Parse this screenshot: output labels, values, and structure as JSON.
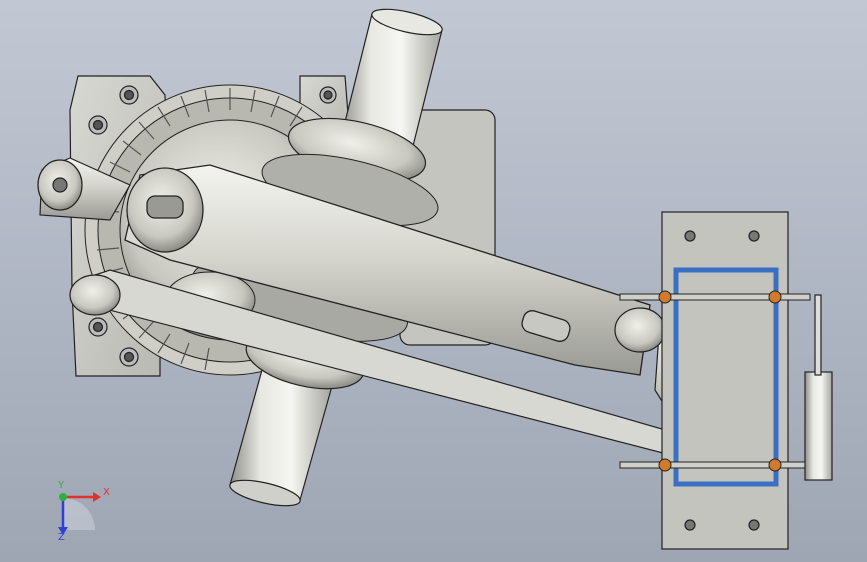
{
  "scene": {
    "background_top": "#c2c8d3",
    "background_bottom": "#9ea6b4",
    "metal_light": "#e6e6e0",
    "metal_mid": "#c9c9c2",
    "metal_dark": "#8e8e88",
    "rail_blue": "#3a6fc4",
    "bolt_orange": "#d07a2a"
  },
  "triad": {
    "x_label": "X",
    "y_label": "Y",
    "z_label": "Z",
    "x_color": "#e03030",
    "y_color": "#2fb040",
    "z_color": "#3040d0"
  }
}
